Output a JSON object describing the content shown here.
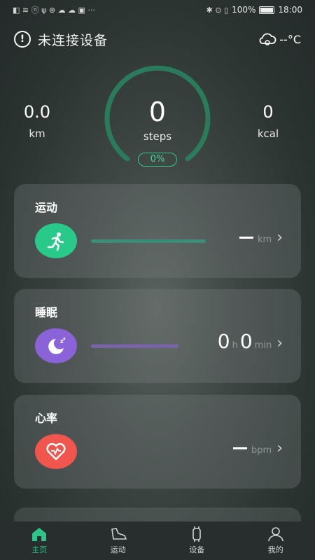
{
  "status_bar": {
    "left_icons": "◧ ≋ ⓝ ψ ⊛ ☁ ☁ ▣ ···",
    "battery": "100%",
    "time": "18:00",
    "right_icons": "✱ ⊙ ▯"
  },
  "header": {
    "device_status": "未连接设备",
    "weather_temp": "--°C"
  },
  "summary": {
    "distance_value": "0.0",
    "distance_unit": "km",
    "steps_value": "0",
    "steps_unit": "steps",
    "progress_label": "0%",
    "progress": 0,
    "calories_value": "0",
    "calories_unit": "kcal"
  },
  "cards": {
    "exercise": {
      "title": "运动",
      "unit": "km",
      "icon": "running-person-icon",
      "color": "#29c98a"
    },
    "sleep": {
      "title": "睡眠",
      "hours": "0",
      "hours_unit": "h",
      "minutes": "0",
      "minutes_unit": "min",
      "icon": "moon-sleep-icon",
      "color": "#8a63d8"
    },
    "heart_rate": {
      "title": "心率",
      "unit": "bpm",
      "icon": "heart-icon",
      "color": "#f0554e"
    }
  },
  "tabs": [
    {
      "label": "主页",
      "icon": "home-icon",
      "active": true
    },
    {
      "label": "运动",
      "icon": "shoe-icon",
      "active": false
    },
    {
      "label": "设备",
      "icon": "watch-icon",
      "active": false
    },
    {
      "label": "我的",
      "icon": "user-icon",
      "active": false
    }
  ],
  "colors": {
    "accent": "#2fc48a",
    "ring": "#2a7a5c"
  }
}
